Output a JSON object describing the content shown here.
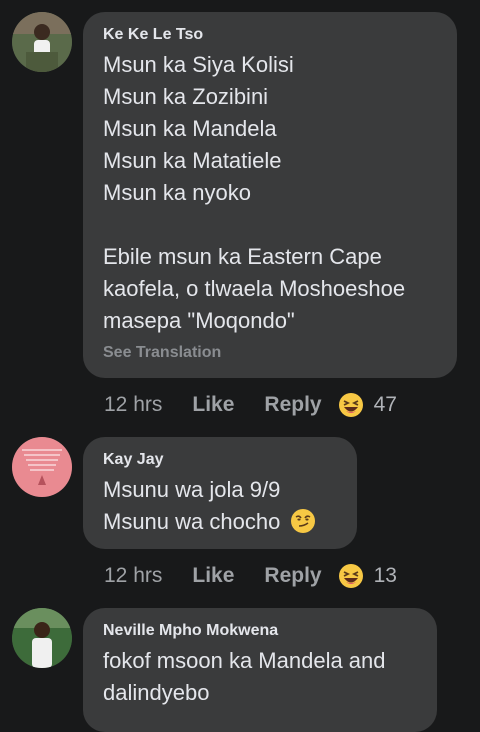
{
  "comments": [
    {
      "author": "Ke Ke Le Tso",
      "lines": [
        "Msun ka Siya Kolisi",
        "Msun ka Zozibini",
        "Msun ka Mandela",
        "Msun ka Matatiele",
        "Msun ka nyoko",
        "",
        "Ebile msun ka Eastern Cape",
        "kaofela, o tlwaela Moshoeshoe",
        "masepa \"Moqondo\""
      ],
      "see_translation": "See Translation",
      "time": "12 hrs",
      "like_label": "Like",
      "reply_label": "Reply",
      "reaction_icon": "laughing-emoji-icon",
      "reaction_count": "47"
    },
    {
      "author": "Kay Jay",
      "lines": [
        "Msunu wa jola 9/9",
        "Msunu wa chocho"
      ],
      "inline_emoji": "smirk-emoji-icon",
      "time": "12 hrs",
      "like_label": "Like",
      "reply_label": "Reply",
      "reaction_icon": "laughing-emoji-icon",
      "reaction_count": "13"
    },
    {
      "author": "Neville Mpho Mokwena",
      "lines": [
        "fokof msoon ka Mandela and",
        "dalindyebo"
      ]
    }
  ],
  "colors": {
    "background": "#18191a",
    "bubble": "#3a3b3c",
    "text": "#e4e6eb",
    "muted": "#9fa2a6",
    "emoji_yellow": "#f7c844"
  }
}
